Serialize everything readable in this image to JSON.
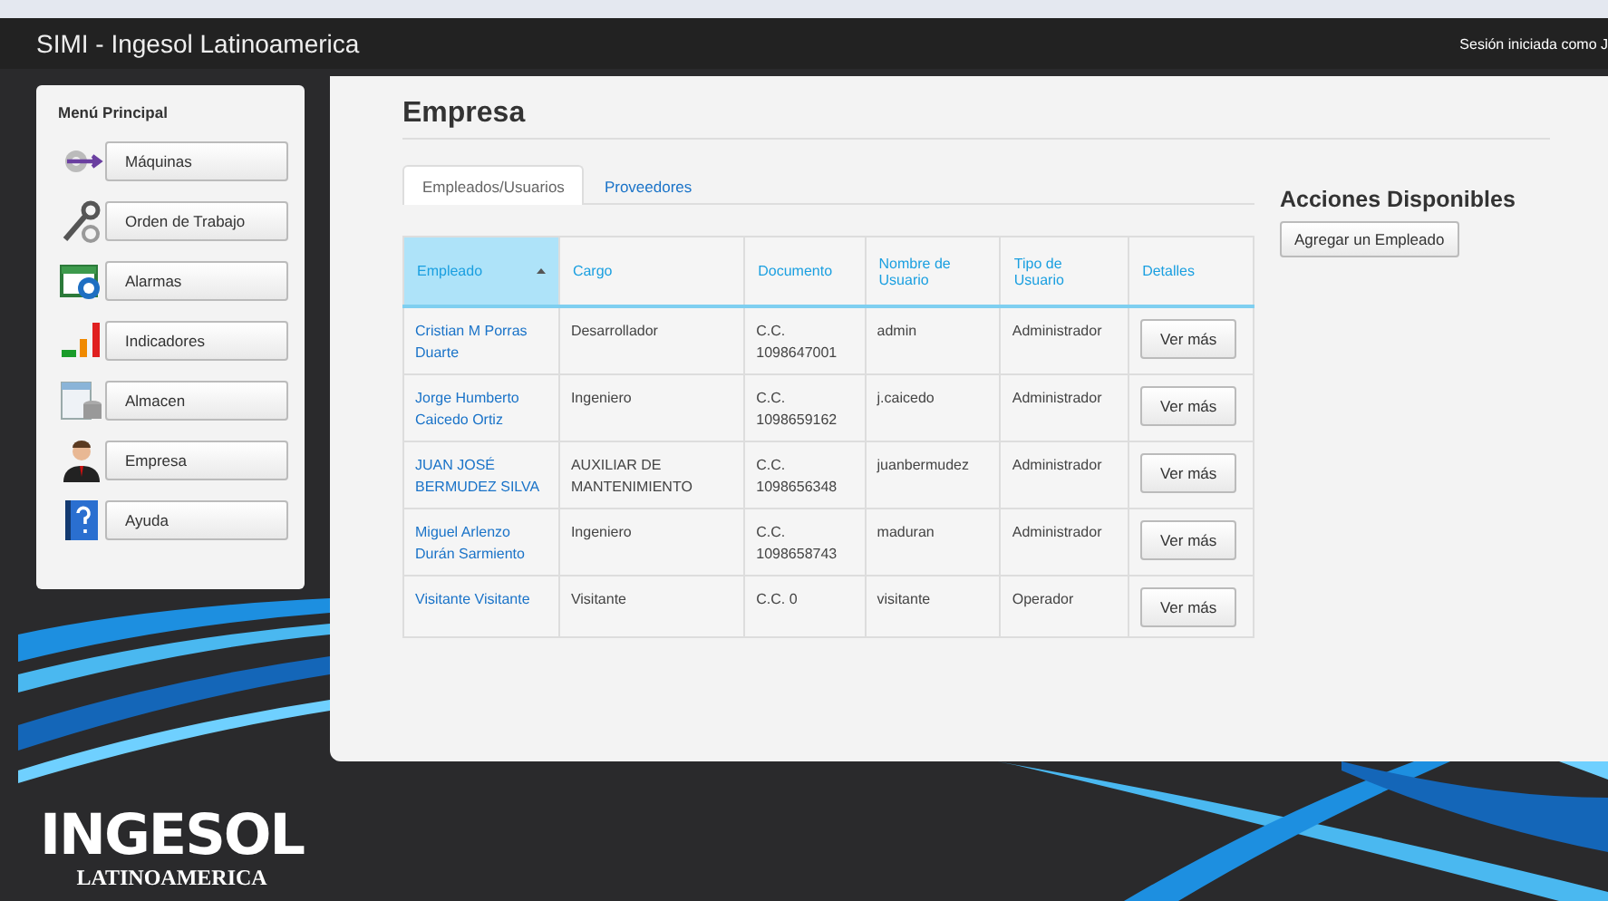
{
  "header": {
    "title": "SIMI - Ingesol Latinoamerica",
    "session": "Sesión iniciada como J"
  },
  "sidebar": {
    "heading": "Menú Principal",
    "items": [
      {
        "label": "Máquinas",
        "kind": "machine"
      },
      {
        "label": "Orden de Trabajo",
        "kind": "tools"
      },
      {
        "label": "Alarmas",
        "kind": "calendar"
      },
      {
        "label": "Indicadores",
        "kind": "bars"
      },
      {
        "label": "Almacen",
        "kind": "storage"
      },
      {
        "label": "Empresa",
        "kind": "person"
      },
      {
        "label": "Ayuda",
        "kind": "help"
      }
    ]
  },
  "main": {
    "title": "Empresa",
    "tabs": [
      {
        "label": "Empleados/Usuarios",
        "selected": true
      },
      {
        "label": "Proveedores",
        "selected": false
      }
    ],
    "table": {
      "columns": [
        {
          "label": "Empleado",
          "sorted": true
        },
        {
          "label": "Cargo",
          "sorted": false
        },
        {
          "label": "Documento",
          "sorted": false
        },
        {
          "label": "Nombre de Usuario",
          "sorted": false
        },
        {
          "label": "Tipo de Usuario",
          "sorted": false
        },
        {
          "label": "Detalles",
          "sorted": false
        }
      ],
      "rows": [
        {
          "empleado": "Cristian M Porras Duarte",
          "cargo": "Desarrollador",
          "documento": "C.C. 1098647001",
          "usuario": "admin",
          "tipo": "Administrador",
          "detalles": "Ver más"
        },
        {
          "empleado": "Jorge Humberto Caicedo Ortiz",
          "cargo": "Ingeniero",
          "documento": "C.C. 1098659162",
          "usuario": "j.caicedo",
          "tipo": "Administrador",
          "detalles": "Ver más"
        },
        {
          "empleado": "JUAN JOSÉ BERMUDEZ SILVA",
          "cargo": "AUXILIAR DE MANTENIMIENTO",
          "documento": "C.C. 1098656348",
          "usuario": "juanbermudez",
          "tipo": "Administrador",
          "detalles": "Ver más"
        },
        {
          "empleado": "Miguel Arlenzo Durán Sarmiento",
          "cargo": "Ingeniero",
          "documento": "C.C. 1098658743",
          "usuario": "maduran",
          "tipo": "Administrador",
          "detalles": "Ver más"
        },
        {
          "empleado": "Visitante Visitante",
          "cargo": "Visitante",
          "documento": "C.C. 0",
          "usuario": "visitante",
          "tipo": "Operador",
          "detalles": "Ver más"
        }
      ]
    },
    "actions": {
      "heading": "Acciones Disponibles",
      "buttons": [
        "Agregar un Empleado"
      ]
    }
  },
  "logo": {
    "name": "INGESOL",
    "subtitle": "LATINOAMERICA"
  }
}
